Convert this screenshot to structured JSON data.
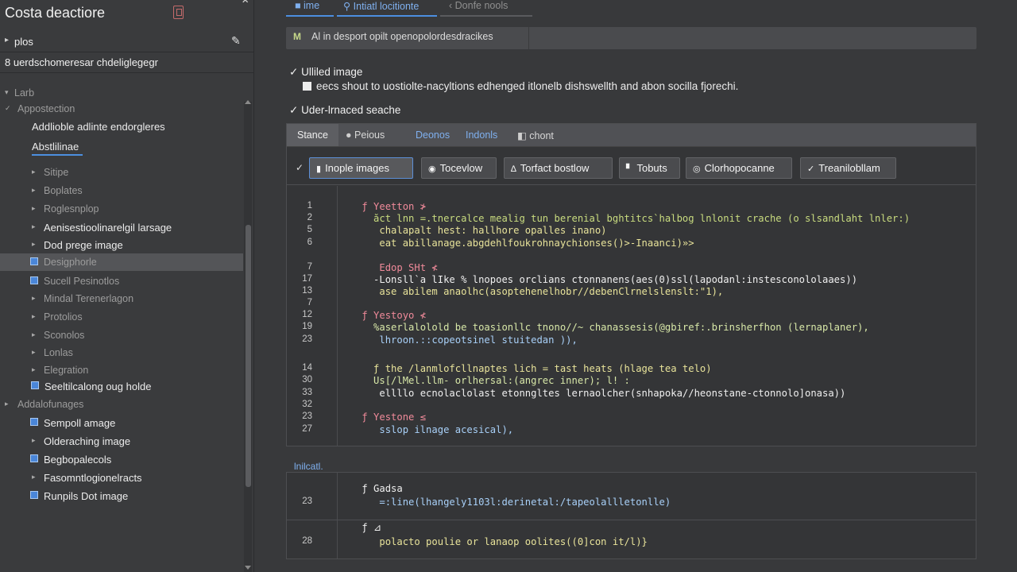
{
  "sidebar": {
    "title": "Costa deactiore",
    "rows": [
      {
        "label": "plos"
      },
      {
        "label": "8 uerdschomeresar chdeliglegegr"
      }
    ],
    "tree": [
      {
        "label": "Larb",
        "kind": "section",
        "arrow": "▾"
      },
      {
        "label": "Appostection",
        "kind": "dim",
        "arrow": "✓"
      },
      {
        "label": "Addlioble adlinte endorgleres",
        "kind": "bright"
      },
      {
        "label": "Abstlilinae",
        "kind": "bright"
      },
      {
        "label": "Sitipe",
        "kind": "dim",
        "arrow": "▸"
      },
      {
        "label": "Boplates",
        "kind": "dim",
        "arrow": "▸"
      },
      {
        "label": "Roglesnplop",
        "kind": "dim",
        "arrow": "▸"
      },
      {
        "label": "Aenisestioolinarelgil larsage",
        "kind": "bright",
        "arrow": "▸"
      },
      {
        "label": "Dod prege image",
        "kind": "bright",
        "arrow": "▸"
      },
      {
        "label": "Desigphorle",
        "kind": "dim",
        "box": true
      },
      {
        "label": "Sucell Pesinotlos",
        "kind": "dim",
        "box": true
      },
      {
        "label": "Mindal Terenerlagon",
        "kind": "dim",
        "arrow": "▸"
      },
      {
        "label": "Protolios",
        "kind": "dim",
        "arrow": "▸"
      },
      {
        "label": "Sconolos",
        "kind": "dim",
        "arrow": "▸"
      },
      {
        "label": "Lonlas",
        "kind": "dim",
        "arrow": "▸"
      },
      {
        "label": "Elegration",
        "kind": "dim",
        "arrow": "▸"
      },
      {
        "label": "Seeltilcalong oug holde",
        "kind": "bright",
        "box": true
      },
      {
        "label": "Addalofunages",
        "kind": "dim",
        "arrow": "▸"
      },
      {
        "label": "Sempoll amage",
        "kind": "bright",
        "box": true
      },
      {
        "label": "Olderaching image",
        "kind": "bright",
        "arrow": "▸"
      },
      {
        "label": "Begbopalecols",
        "kind": "bright",
        "box": true
      },
      {
        "label": "Fasomntlogionelracts",
        "kind": "bright",
        "arrow": "▸"
      },
      {
        "label": "Runpils Dot image",
        "kind": "bright",
        "box": true
      }
    ]
  },
  "top_tabs": [
    {
      "label": "■ ime"
    },
    {
      "label": "Intiatl locitionte"
    },
    {
      "label": "Donfe nools"
    }
  ],
  "search": {
    "badge": "M",
    "value": "Al in desport opilt openopolordesdracikes"
  },
  "checks": [
    {
      "mark": "✓",
      "label": "Ulliled image"
    },
    {
      "mark": "✓",
      "label": "Uder-lrnaced seache"
    }
  ],
  "subtext": "eecs shout to uostiolte-nacyltions edhenged itlonelb dishswellth and abon socilla fjorechi.",
  "panel": {
    "tabs": [
      {
        "label": "Stance",
        "style": "active"
      },
      {
        "label": "Peious",
        "style": "plain",
        "icon": "●"
      },
      {
        "label": "Deonos",
        "style": "link"
      },
      {
        "label": "Indonls",
        "style": "link"
      },
      {
        "label": "chont",
        "style": "plain",
        "icon": "◧"
      }
    ],
    "tools": [
      {
        "label": "Inople images",
        "icon": "▮",
        "active": true
      },
      {
        "label": "Tocevlow",
        "icon": "◉"
      },
      {
        "label": "Torfact bostlow",
        "icon": "∆"
      },
      {
        "label": "Tobuts",
        "icon": "▘"
      },
      {
        "label": "Clorhopocanne",
        "icon": "◎"
      },
      {
        "label": "Treanilobllam",
        "icon": "✓"
      }
    ],
    "code_lines": [
      {
        "ln": "1",
        "text": "    ƒ Yeetton ≯",
        "color": "pink"
      },
      {
        "ln": "2",
        "text": "      ăct lnn =.tnercalce mealig tun berenial bghtitcs`halbog lnlonit crache (o slsandlaht lnler:)",
        "color": "green"
      },
      {
        "ln": "5",
        "text": "       chalapalt hest: hallhore opalles inano)",
        "color": "yellow"
      },
      {
        "ln": "6",
        "text": "       eat abillanage.abgdehlfoukrohnaychionses()>-Inaanci)»>",
        "color": "yellow"
      },
      {
        "ln": "7",
        "text": "       Edop SHt ≮",
        "color": "pink"
      },
      {
        "ln": "17",
        "text": "      -Lonsll`a lIke % lnopoes orclians ctonnanens(aes(0)ssl(lapodanl:instesconololaaes))",
        "color": "white"
      },
      {
        "ln": "13",
        "text": "       ase abilem anaolhc(asoptehenelhobr//debenClrnelslenslt:\"1),",
        "color": "yellow"
      },
      {
        "ln": "7",
        "text": "",
        "color": "white"
      },
      {
        "ln": "12",
        "text": "    ƒ Yestoyo ≮",
        "color": "pink"
      },
      {
        "ln": "19",
        "text": "      %aserlalolold be toasionllc tnono//~ chanassesis(@gbiref:.brinsherfhon (lernaplaner),",
        "color": "mix"
      },
      {
        "ln": "23",
        "text": "       lhroon.::copeotsinel stuitedan )),",
        "color": "lblue"
      },
      {
        "ln": "",
        "text": "",
        "color": "white"
      },
      {
        "ln": "14",
        "text": "      ƒ the /lanmlofcllnaptes lich = tast heats (hlage tea telo)",
        "color": "yellow"
      },
      {
        "ln": "30",
        "text": "      Us[/lMel.llm- orlhersal:(angrec inner); l! :",
        "color": "mix"
      },
      {
        "ln": "33",
        "text": "       ellllo ecnolaclolast etonngltes lernaolcher(snhapoka//heonstane-ctonnolo]onasa))",
        "color": "white"
      },
      {
        "ln": "32",
        "text": "",
        "color": "white"
      },
      {
        "ln": "23",
        "text": "    ƒ Yestone ≤",
        "color": "pink"
      },
      {
        "ln": "27",
        "text": "       sslop ilnage acesical),",
        "color": "lblue"
      }
    ]
  },
  "section_label": "lnilcatl.",
  "panel2": {
    "lines": [
      {
        "ln": "",
        "text": "    ƒ Gadsa",
        "color": "white"
      },
      {
        "ln": "23",
        "text": "       =:line(lhangely1103l:derinetal:/tapeolallletonlle)",
        "color": "lblue"
      },
      {
        "ln": "",
        "text": "    ƒ ⊿",
        "color": "white"
      },
      {
        "ln": "28",
        "text": "       polacto poulie or lanaop oolites((0]con it/l)}",
        "color": "yellow"
      }
    ]
  },
  "colors": {
    "accent": "#4c8fe0",
    "link": "#7fb0ef",
    "background": "#38393b"
  }
}
